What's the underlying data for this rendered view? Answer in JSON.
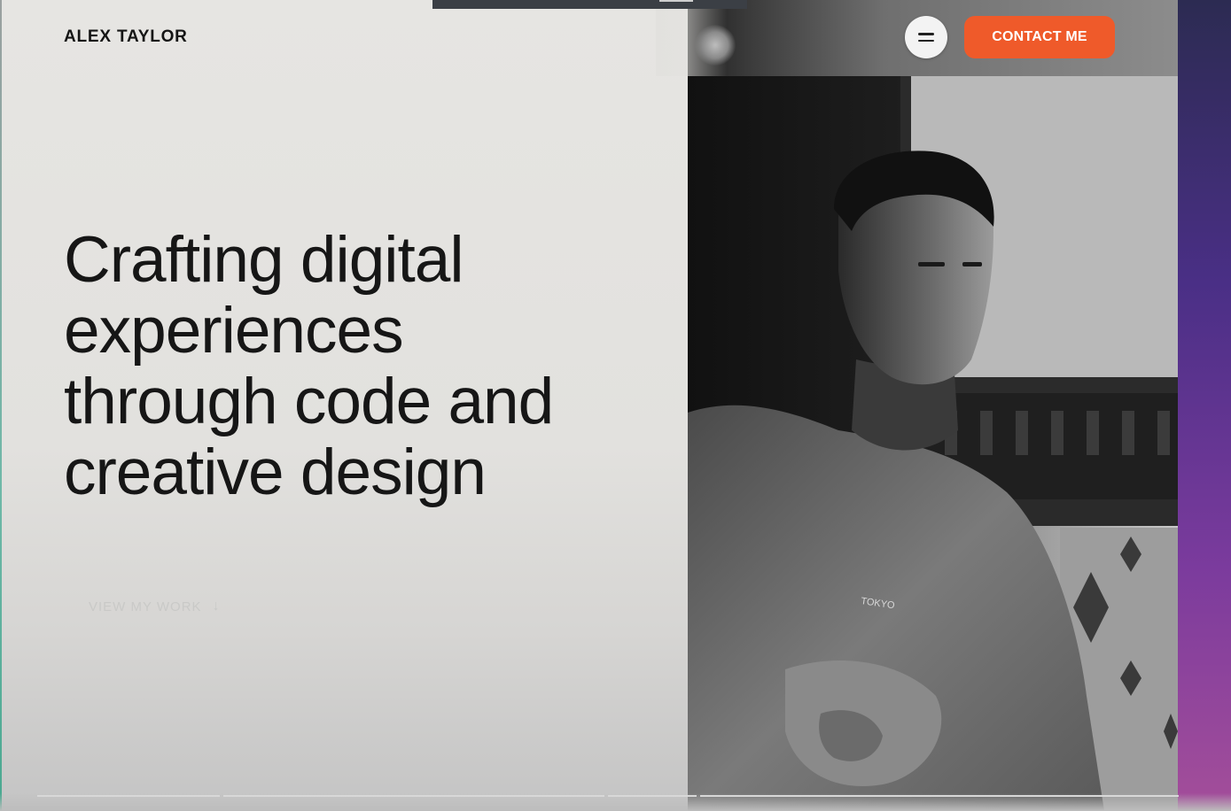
{
  "header": {
    "logo_text": "ALEX TAYLOR",
    "menu_icon": "hamburger-icon",
    "contact_label": "CONTACT ME"
  },
  "hero": {
    "title_lines": [
      "Crafting digital",
      "experiences",
      "through code and",
      "creative design"
    ],
    "cta_label": "VIEW MY WORK",
    "cta_icon": "arrow-down-icon"
  },
  "photo": {
    "shirt_text": "TOKYO"
  },
  "colors": {
    "accent": "#ef5a2a",
    "background": "#e4e3e0",
    "text": "#161616"
  }
}
